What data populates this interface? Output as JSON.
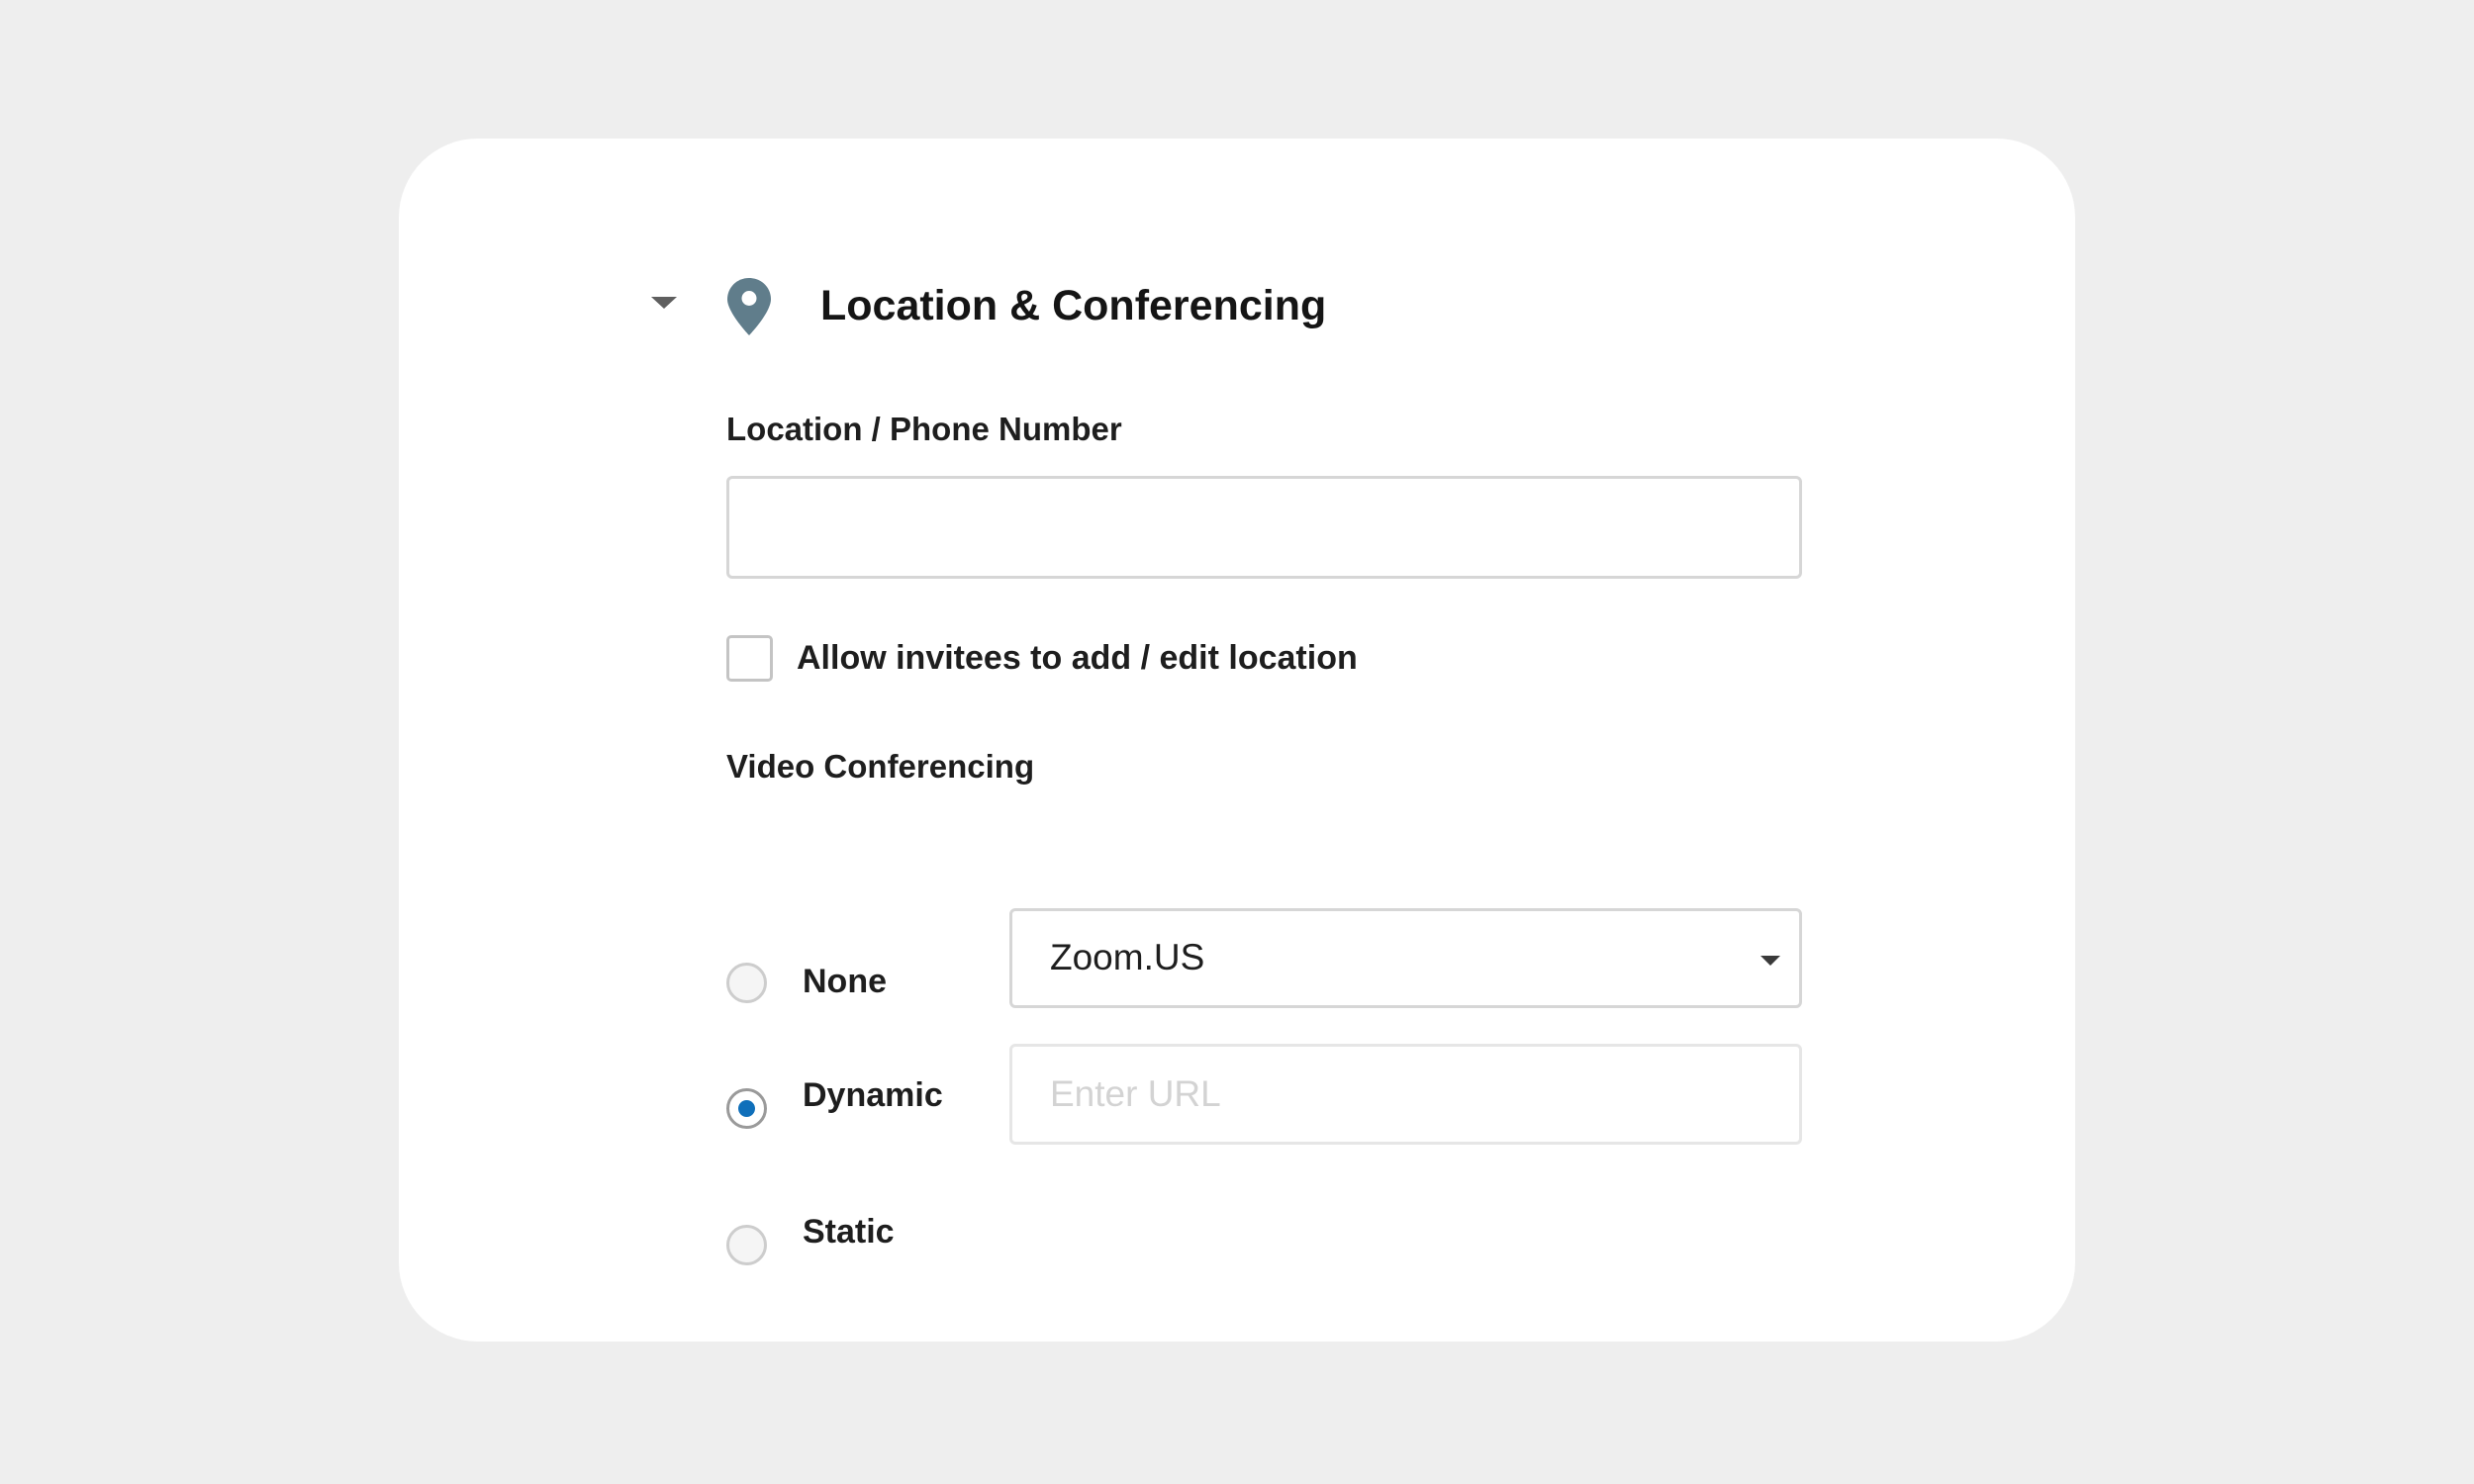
{
  "section": {
    "title": "Location & Conferencing",
    "collapse_icon": "caret-down-icon",
    "header_icon": "map-pin-icon"
  },
  "location": {
    "label": "Location / Phone Number",
    "value": "",
    "placeholder": ""
  },
  "allow_edit": {
    "label": "Allow invitees to add / edit location",
    "checked": false
  },
  "video": {
    "label": "Video Conferencing",
    "options": [
      {
        "label": "None",
        "selected": false
      },
      {
        "label": "Dynamic",
        "selected": true
      },
      {
        "label": "Static",
        "selected": false
      }
    ],
    "dynamic_provider": "Zoom.US",
    "static_url_placeholder": "Enter URL"
  },
  "colors": {
    "background": "#eeeeee",
    "card": "#ffffff",
    "accent": "#0f6fba",
    "icon": "#607d8b",
    "text": "#1e1e1e",
    "border": "#d6d6d6"
  }
}
